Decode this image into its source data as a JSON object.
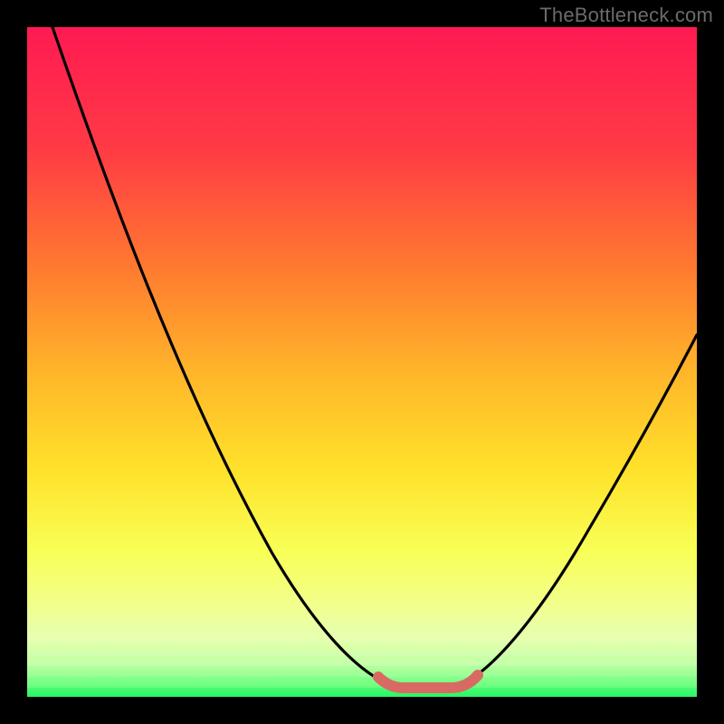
{
  "watermark": "TheBottleneck.com",
  "colors": {
    "gradient_top": "#ff1a52",
    "gradient_mid1": "#ff8a2a",
    "gradient_mid2": "#ffe12a",
    "gradient_mid3": "#f6ff63",
    "gradient_band": "#e6ff9b",
    "gradient_bottom": "#27f765",
    "curve": "#000000",
    "accent": "#d96a63"
  },
  "chart_data": {
    "type": "line",
    "title": "",
    "xlabel": "",
    "ylabel": "",
    "xlim": [
      0,
      100
    ],
    "ylim": [
      0,
      100
    ],
    "series": [
      {
        "name": "bottleneck-curve",
        "x": [
          4,
          10,
          16,
          22,
          28,
          34,
          40,
          46,
          50,
          54,
          57,
          60,
          63,
          66,
          70,
          76,
          82,
          88,
          94,
          100
        ],
        "y": [
          100,
          88,
          76,
          64,
          52,
          40,
          28,
          16,
          8,
          2,
          0,
          0,
          0,
          2,
          8,
          18,
          30,
          42,
          52,
          60
        ]
      },
      {
        "name": "valley-highlight",
        "x": [
          54,
          56,
          58,
          60,
          62,
          64,
          66
        ],
        "y": [
          2,
          0.5,
          0,
          0,
          0,
          0.5,
          2
        ]
      }
    ],
    "annotations": []
  }
}
